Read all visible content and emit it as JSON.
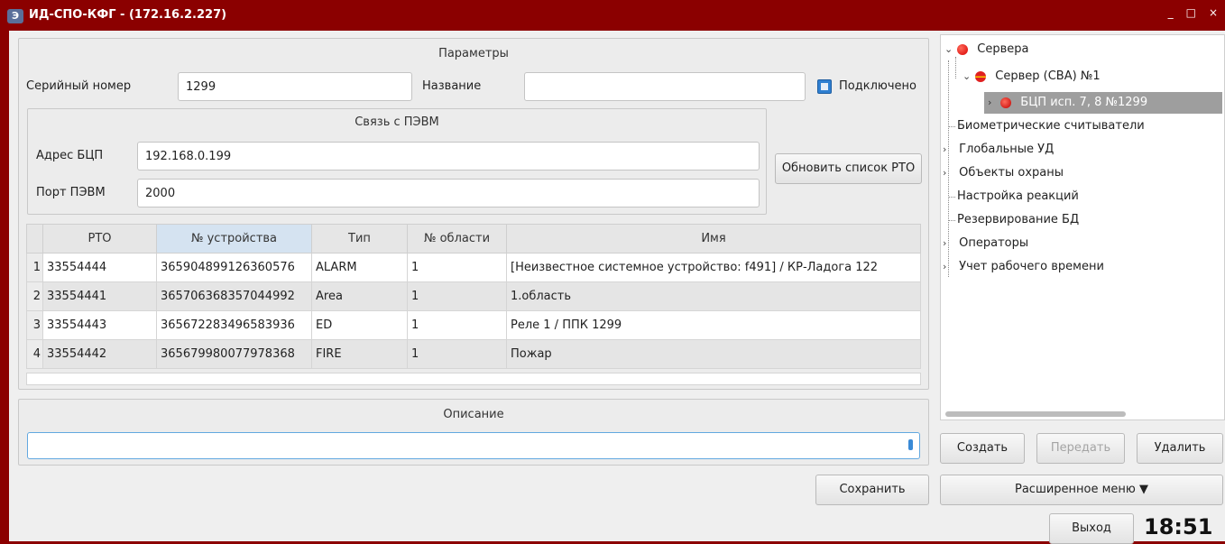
{
  "window": {
    "icon_text": "Э",
    "title": "ИД-СПО-КФГ -  (172.16.2.227)",
    "minimize": "_",
    "maximize": "□",
    "close": "×"
  },
  "params": {
    "title": "Параметры",
    "serial_label": "Серийный номер",
    "serial_value": "1299",
    "name_label": "Название",
    "name_value": "",
    "connected_label": "Подключено",
    "connected": true
  },
  "link": {
    "title": "Связь с ПЭВМ",
    "address_label": "Адрес БЦП",
    "address_value": "192.168.0.199",
    "port_label": "Порт ПЭВМ",
    "port_value": "2000",
    "refresh_button": "Обновить список РТО"
  },
  "table": {
    "columns": [
      "РТО",
      "№ устройства",
      "Тип",
      "№ области",
      "Имя"
    ],
    "rows": [
      {
        "n": "1",
        "rto": "33554444",
        "device": "365904899126360576",
        "type": "ALARM",
        "area": "1",
        "name": "[Неизвестное системное устройство: f491]  / КР-Ладога 122"
      },
      {
        "n": "2",
        "rto": "33554441",
        "device": "365706368357044992",
        "type": "Area",
        "area": "1",
        "name": "1.область"
      },
      {
        "n": "3",
        "rto": "33554443",
        "device": "365672283496583936",
        "type": "ED",
        "area": "1",
        "name": "Реле 1 / ППК 1299"
      },
      {
        "n": "4",
        "rto": "33554442",
        "device": "365679980077978368",
        "type": "FIRE",
        "area": "1",
        "name": "Пожар"
      }
    ]
  },
  "description": {
    "title": "Описание",
    "value": ""
  },
  "save_button": "Сохранить",
  "tree": {
    "root": "Сервера",
    "server": "Сервер (СВА) №1",
    "device": "БЦП исп. 7, 8 №1299",
    "items": [
      "Биометрические считыватели",
      "Глобальные УД",
      "Объекты охраны",
      "Настройка реакций",
      "Резервирование БД",
      "Операторы",
      "Учет рабочего времени"
    ]
  },
  "actions": {
    "create": "Создать",
    "send": "Передать",
    "delete": "Удалить",
    "extended_menu": "Расширенное меню ▼",
    "exit": "Выход"
  },
  "clock": "18:51",
  "colors": {
    "titlebar": "#8b0000",
    "selection": "#9e9e9e",
    "checkbox": "#2f7fd1"
  }
}
